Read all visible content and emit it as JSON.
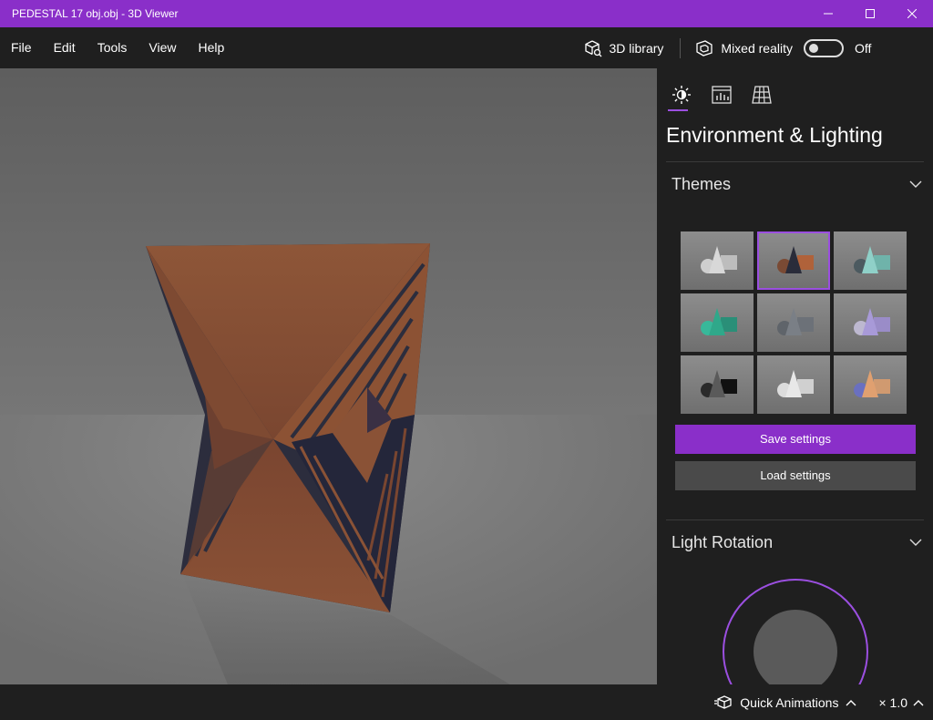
{
  "window": {
    "title": "PEDESTAL 17 obj.obj - 3D Viewer"
  },
  "menu": {
    "items": [
      "File",
      "Edit",
      "Tools",
      "View",
      "Help"
    ]
  },
  "toolbar": {
    "library_label": "3D library",
    "mixed_reality_label": "Mixed reality",
    "mixed_reality_state": "Off"
  },
  "panel": {
    "title": "Environment & Lighting",
    "themes_header": "Themes",
    "save_label": "Save settings",
    "load_label": "Load settings",
    "light_rotation_header": "Light Rotation"
  },
  "status": {
    "quick_animations_label": "Quick Animations",
    "speed": "× 1.0"
  },
  "colors": {
    "accent": "#8a2fc9",
    "model": "#8a5235",
    "model_dark": "#2e3042"
  }
}
